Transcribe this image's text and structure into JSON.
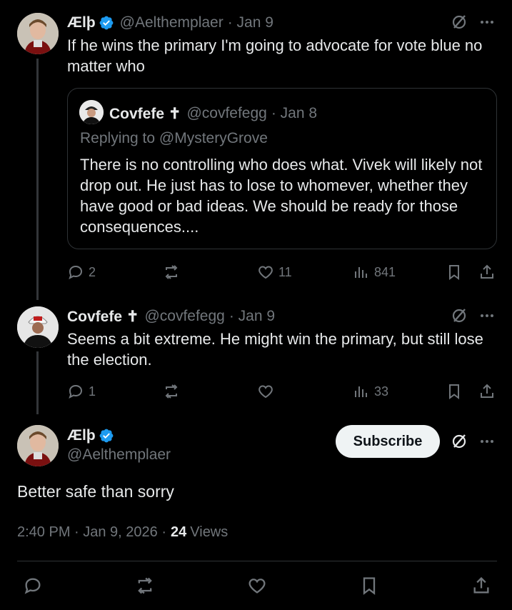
{
  "tweet1": {
    "name": "Ælþ",
    "handle": "@Aelthemplaer",
    "date": "· Jan 9",
    "text": "If he wins the primary I'm going to advocate for vote blue no matter who",
    "quote": {
      "name": "Covfefe ✝",
      "handle": "@covfefegg",
      "date": "· Jan 8",
      "replying_to": "Replying to @MysteryGrove",
      "text": "There is no controlling who does what. Vivek will likely not drop out. He just has to lose to whomever, whether they have good or bad ideas. We should be ready for those consequences...."
    },
    "replies": "2",
    "likes": "11",
    "views": "841"
  },
  "tweet2": {
    "name": "Covfefe ✝",
    "handle": "@covfefegg",
    "date": "· Jan 9",
    "text": "Seems a bit extreme. He might win the primary, but still lose the election.",
    "replies": "1",
    "views": "33"
  },
  "main": {
    "name": "Ælþ",
    "handle": "@Aelthemplaer",
    "subscribe": "Subscribe",
    "text": "Better safe than sorry",
    "timestamp": "2:40 PM · Jan 9, 2026 ·",
    "views_count": "24",
    "views_label": "Views"
  },
  "colors": {
    "background": "#000000",
    "text": "#e7e9ea",
    "muted": "#71767b",
    "verified": "#1d9bf0",
    "border": "#2f3336"
  }
}
